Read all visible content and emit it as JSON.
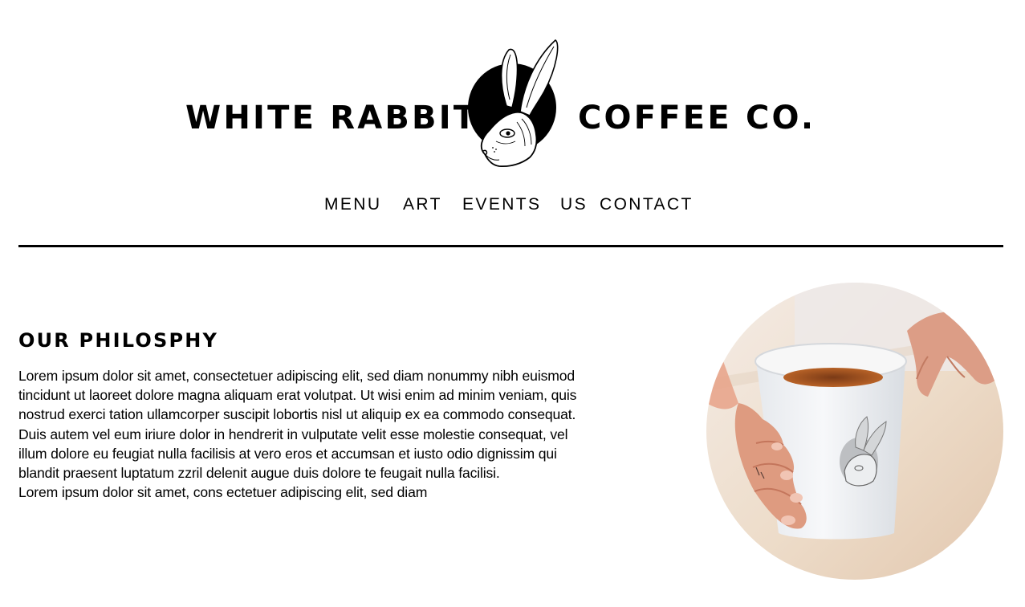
{
  "header": {
    "brand_left": "WHITE RABBIT",
    "brand_right": "COFFEE CO.",
    "logo_icon": "rabbit-head-logo-icon"
  },
  "nav": {
    "items": [
      {
        "label": "MENU"
      },
      {
        "label": "ART"
      },
      {
        "label": "EVENTS"
      },
      {
        "label": "US"
      },
      {
        "label": "CONTACT"
      }
    ]
  },
  "main": {
    "title": "OUR PHILOSPHY",
    "body_lines": [
      "Lorem ipsum dolor sit amet, consectetuer adipiscing elit, sed diam nonummy nibh euismod",
      "tincidunt ut laoreet dolore magna aliquam erat volutpat. Ut wisi enim ad minim veniam, quis",
      "nostrud exerci tation ullamcorper suscipit lobortis nisl ut aliquip ex ea commodo consequat.",
      "Duis autem vel eum iriure dolor in hendrerit in vulputate velit esse molestie consequat, vel",
      "illum dolore eu feugiat nulla facilisis at vero eros et accumsan et iusto odio dignissim qui",
      "blandit praesent luptatum zzril delenit augue duis dolore te feugait nulla facilisi.",
      "Lorem ipsum dolor sit amet, cons ectetuer adipiscing elit, sed diam"
    ],
    "photo_icon": "coffee-cup-photo"
  },
  "colors": {
    "text": "#000000",
    "background": "#ffffff",
    "coffee": "#b5652b",
    "table": "#e9d8c6"
  }
}
